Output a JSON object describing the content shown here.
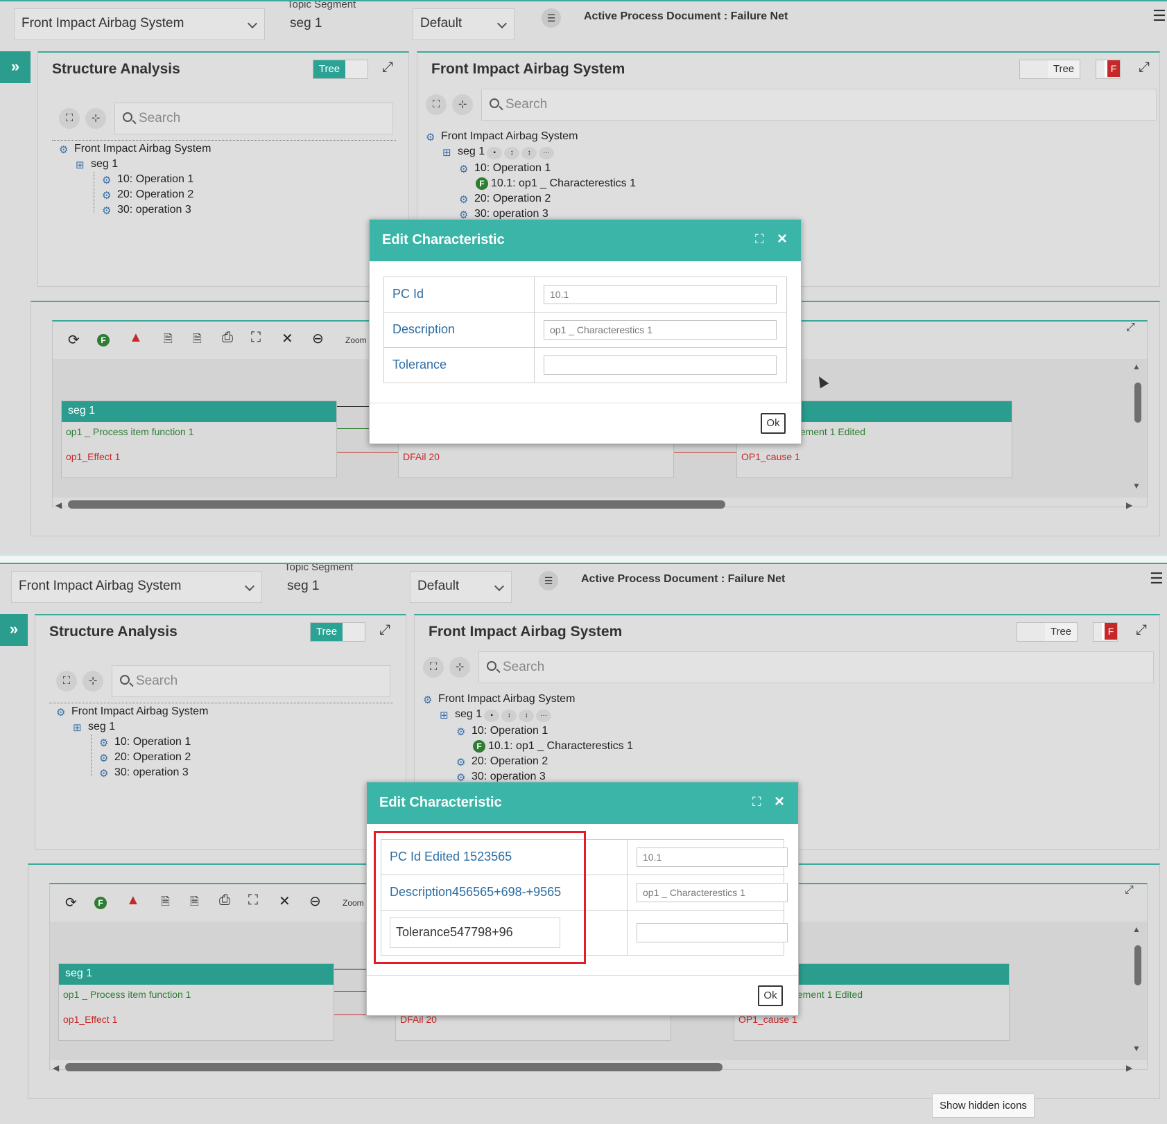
{
  "header": {
    "system_select": "Front Impact Airbag System",
    "topic_label": "Topic Segment",
    "topic_value": "seg 1",
    "default_select": "Default",
    "active_doc": "Active Process Document : Failure Net"
  },
  "left_panel": {
    "title": "Structure Analysis",
    "toggle_label": "Tree",
    "search_placeholder": "Search",
    "tree": [
      "Front Impact Airbag System",
      "seg 1",
      "10: Operation 1",
      "20: Operation 2",
      "30: operation 3"
    ]
  },
  "right_panel": {
    "title": "Front Impact Airbag System",
    "toggle_label": "Tree",
    "f_label": "F",
    "search_placeholder": "Search",
    "tree": [
      "Front Impact Airbag System",
      "seg 1",
      "10: Operation 1",
      "10.1: op1 _ Characterestics 1",
      "20: Operation 2",
      "30: operation 3"
    ],
    "f_badge": "F"
  },
  "toolbar": {
    "f_green": "F",
    "f_red": "F",
    "zoom_label": "Zoom"
  },
  "diagram": {
    "node1": {
      "header": "seg 1",
      "function": "op1 _ Process item function 1",
      "effect": "op1_Effect 1"
    },
    "node2": {
      "effect": "DFAil 20"
    },
    "node3": {
      "function": "element 1 Edited",
      "effect": "OP1_cause 1"
    }
  },
  "dialog1": {
    "title": "Edit Characteristic",
    "rows": [
      {
        "label": "PC Id",
        "value": "10.1"
      },
      {
        "label": "Description",
        "value": "op1 _ Characterestics 1"
      },
      {
        "label": "Tolerance",
        "value": ""
      }
    ],
    "ok": "Ok"
  },
  "dialog2": {
    "title": "Edit Characteristic",
    "rows": [
      {
        "label": "PC Id Edited 1523565",
        "value": "10.1"
      },
      {
        "label": "Description456565+698-+9565",
        "value": "op1 _ Characterestics 1"
      },
      {
        "label": "Tolerance547798+96",
        "value": ""
      }
    ],
    "ok": "Ok"
  },
  "tooltip": "Show hidden icons",
  "colors": {
    "accent": "#2a9d8f",
    "dialog_header": "#3ab5a8",
    "highlight": "#e21d26",
    "effect": "#c62828",
    "function": "#2e7d32"
  }
}
